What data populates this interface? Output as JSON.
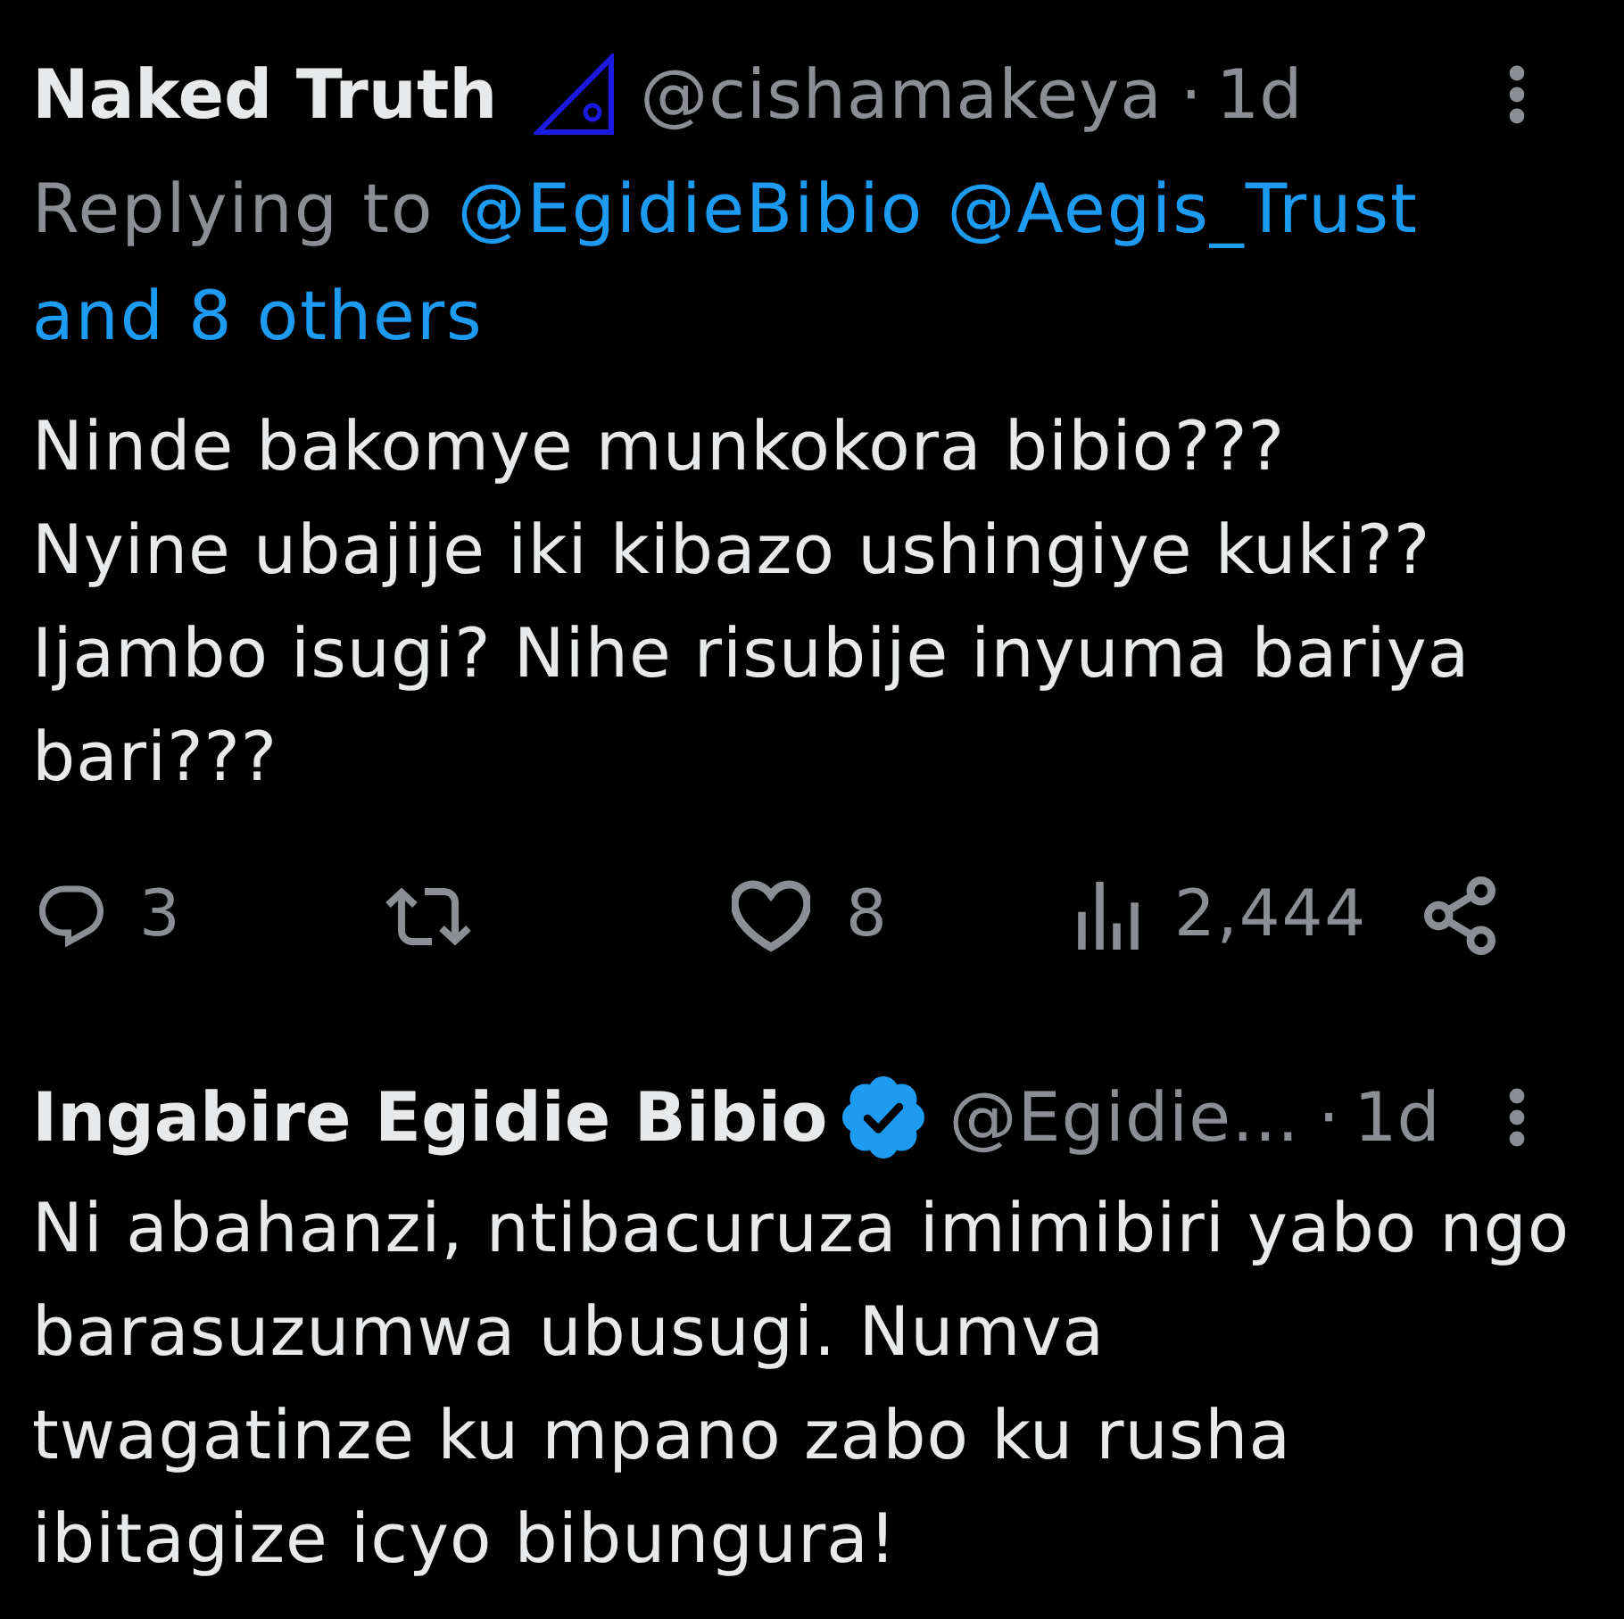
{
  "tweets": [
    {
      "author": {
        "name": "Naked Truth",
        "badge": {
          "kind": "set_square"
        },
        "handle": "@cishamakeya",
        "separator": "·",
        "time": "1d"
      },
      "reply_to": {
        "label": "Replying to",
        "mentions": [
          "@EgidieBibio",
          "@Aegis_Trust"
        ],
        "others": "and 8 others"
      },
      "text": "Ninde bakomye munkokora bibio???\nNyine ubajije iki kibazo ushingiye kuki??\nIjambo isugi? Nihe risubije inyuma bariya\nbari???",
      "actions": [
        {
          "kind": "reply",
          "count": "3"
        },
        {
          "kind": "repost"
        },
        {
          "kind": "like",
          "count": "8"
        },
        {
          "kind": "views",
          "count": "2,444"
        },
        {
          "kind": "share"
        }
      ]
    },
    {
      "author": {
        "name": "Ingabire Egidie Bibio",
        "badge": {
          "kind": "verified"
        },
        "handle": "@Egidie…",
        "separator": "·",
        "time": "1d"
      },
      "text": "Ni abahanzi, ntibacuruza imimibiri yabo ngo\nbarasuzumwa ubusugi. Numva\ntwagatinze ku mpano zabo ku rusha\nibitagize icyo bibungura!"
    }
  ]
}
